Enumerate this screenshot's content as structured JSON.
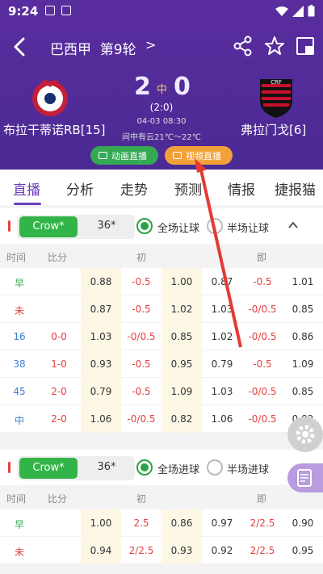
{
  "status": {
    "time": "9:24"
  },
  "header": {
    "title": "巴西甲",
    "round": "第9轮",
    "chevron": ">"
  },
  "match": {
    "home_team": "布拉干蒂诺RB[15]",
    "away_team": "弗拉门戈[6]",
    "home_score": "2",
    "away_score": "0",
    "status_label": "中",
    "half_score": "(2:0)",
    "datetime": "04-03 08:30",
    "weather": "间中有云21℃～22℃",
    "live_anim": "动画直播",
    "live_video": "视频直播"
  },
  "tabs": [
    "直播",
    "分析",
    "走势",
    "预测",
    "情报",
    "捷报猫"
  ],
  "section1": {
    "book": "Crow*",
    "value": "36*",
    "opt_full": "全场让球",
    "opt_half": "半场让球",
    "caret": "^",
    "headers": {
      "time": "时间",
      "score": "比分",
      "init": "初",
      "now": "即"
    },
    "rows": [
      {
        "time": "早",
        "score": "",
        "a": "0.88",
        "b": "-0.5",
        "c": "1.00",
        "d": "0.87",
        "e": "-0.5",
        "f": "1.01"
      },
      {
        "time": "未",
        "score": "",
        "a": "0.87",
        "b": "-0.5",
        "c": "1.02",
        "d": "1.03",
        "e": "-0/0.5",
        "f": "0.85"
      },
      {
        "time": "16",
        "score": "0-0",
        "a": "1.03",
        "b": "-0/0.5",
        "c": "0.85",
        "d": "1.02",
        "e": "-0/0.5",
        "f": "0.86"
      },
      {
        "time": "38",
        "score": "1-0",
        "a": "0.93",
        "b": "-0.5",
        "c": "0.95",
        "d": "0.79",
        "e": "-0.5",
        "f": "1.09"
      },
      {
        "time": "45",
        "score": "2-0",
        "a": "0.79",
        "b": "-0.5",
        "c": "1.09",
        "d": "1.03",
        "e": "-0/0.5",
        "f": "0.85"
      },
      {
        "time": "中",
        "score": "2-0",
        "a": "1.06",
        "b": "-0/0.5",
        "c": "0.82",
        "d": "1.06",
        "e": "-0/0.5",
        "f": "0.82"
      }
    ]
  },
  "section2": {
    "book": "Crow*",
    "value": "36*",
    "opt_full": "全场进球",
    "opt_half": "半场进球",
    "headers": {
      "time": "时间",
      "score": "比分",
      "init": "初",
      "now": "即"
    },
    "rows": [
      {
        "time": "早",
        "score": "",
        "a": "1.00",
        "b": "2.5",
        "c": "0.86",
        "d": "0.97",
        "e": "2/2.5",
        "f": "0.90"
      },
      {
        "time": "未",
        "score": "",
        "a": "0.94",
        "b": "2/2.5",
        "c": "0.93",
        "d": "0.92",
        "e": "2/2.5",
        "f": "0.95"
      }
    ]
  },
  "colors": {
    "accent": "#6a3fbf",
    "header_bg": "#4b2a94",
    "green": "#33b449",
    "red": "#e34040",
    "blue": "#3a7fd6",
    "orange": "#f2a13a"
  }
}
